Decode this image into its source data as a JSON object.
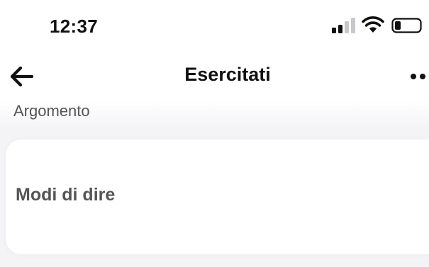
{
  "status_bar": {
    "time": "12:37",
    "icons": [
      "cellular-signal-icon",
      "wifi-icon",
      "battery-icon"
    ]
  },
  "nav": {
    "back_icon": "arrow-left-icon",
    "title": "Esercitati",
    "more_icon": "more-dots-icon"
  },
  "section": {
    "label": "Argomento"
  },
  "topic_card": {
    "label": "Modi di dire"
  },
  "colors": {
    "background": "#f4f4f6",
    "card": "#ffffff",
    "text_primary": "#111111",
    "text_secondary": "#555555"
  }
}
